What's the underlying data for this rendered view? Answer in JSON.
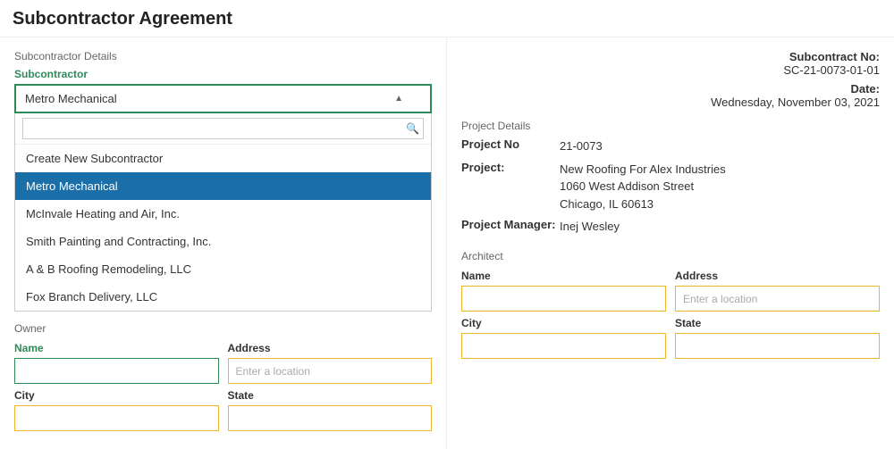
{
  "title": "Subcontractor Agreement",
  "left": {
    "subcontractor_section_label": "Subcontractor Details",
    "subcontractor_field_label": "Subcontractor",
    "selected_value": "Metro Mechanical",
    "search_placeholder": "",
    "dropdown_items": [
      {
        "id": "create",
        "label": "Create New Subcontractor",
        "selected": false
      },
      {
        "id": "metro",
        "label": "Metro Mechanical",
        "selected": true
      },
      {
        "id": "mcinvale",
        "label": "McInvale Heating and Air, Inc.",
        "selected": false
      },
      {
        "id": "smith",
        "label": "Smith Painting and Contracting, Inc.",
        "selected": false
      },
      {
        "id": "ab",
        "label": "A & B Roofing Remodeling, LLC",
        "selected": false
      },
      {
        "id": "fox",
        "label": "Fox Branch Delivery, LLC",
        "selected": false
      }
    ],
    "owner_label": "Owner",
    "owner_name_label": "Name",
    "owner_address_label": "Address",
    "owner_address_placeholder": "Enter a location",
    "owner_city_label": "City",
    "owner_state_label": "State"
  },
  "right": {
    "subcontract_no_label": "Subcontract No:",
    "subcontract_no_value": "SC-21-0073-01-01",
    "date_label": "Date:",
    "date_value": "Wednesday, November 03, 2021",
    "project_details_label": "Project Details",
    "project_no_label": "Project No",
    "project_no_value": "21-0073",
    "project_label": "Project:",
    "project_line1": "New Roofing For Alex Industries",
    "project_line2": "1060 West Addison Street",
    "project_line3": "Chicago, IL 60613",
    "project_manager_label": "Project Manager:",
    "project_manager_value": "Inej Wesley",
    "architect_label": "Architect",
    "architect_name_label": "Name",
    "architect_address_label": "Address",
    "architect_address_placeholder": "Enter a location",
    "architect_city_label": "City",
    "architect_state_label": "State"
  }
}
